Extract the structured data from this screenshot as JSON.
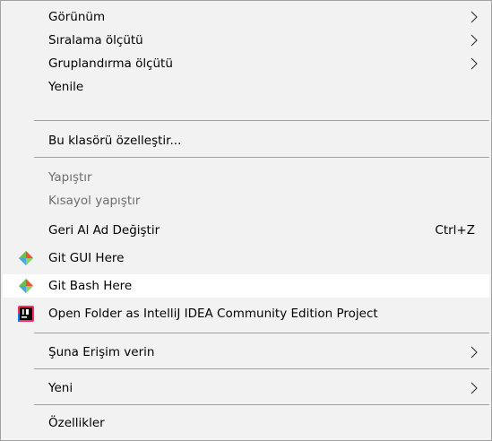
{
  "menu": {
    "items": [
      {
        "label": "Görünüm",
        "submenu": true,
        "disabled": false
      },
      {
        "label": "Sıralama ölçütü",
        "submenu": true,
        "disabled": false
      },
      {
        "label": "Gruplandırma ölçütü",
        "submenu": true,
        "disabled": false
      },
      {
        "label": "Yenile",
        "submenu": false,
        "disabled": false
      },
      {
        "label": "Bu klasörü özelleştir...",
        "submenu": false,
        "disabled": false
      },
      {
        "label": "Yapıştır",
        "submenu": false,
        "disabled": true
      },
      {
        "label": "Kısayol yapıştır",
        "submenu": false,
        "disabled": true
      },
      {
        "label": "Geri Al Ad Değiştir",
        "shortcut": "Ctrl+Z",
        "submenu": false,
        "disabled": false
      },
      {
        "label": "Git GUI Here",
        "icon": "git-diamond-icon",
        "submenu": false,
        "disabled": false
      },
      {
        "label": "Git Bash Here",
        "icon": "git-diamond-icon",
        "submenu": false,
        "disabled": false,
        "highlighted": true
      },
      {
        "label": "Open Folder as IntelliJ IDEA Community Edition Project",
        "icon": "intellij-idea-icon",
        "submenu": false,
        "disabled": false
      },
      {
        "label": "Şuna Erişim verin",
        "submenu": true,
        "disabled": false
      },
      {
        "label": "Yeni",
        "submenu": true,
        "disabled": false
      },
      {
        "label": "Özellikler",
        "submenu": false,
        "disabled": false
      }
    ]
  },
  "colors": {
    "menu_background": "#f2f2f2",
    "highlight_background": "#ffffff",
    "separator": "#a0a0a0",
    "disabled_text": "#6d6d6d",
    "git_orange": "#f05033",
    "git_blue": "#4aa8e0",
    "git_green": "#6cc04a",
    "intellij_pink": "#fc2c64",
    "intellij_blue": "#087cfa"
  }
}
